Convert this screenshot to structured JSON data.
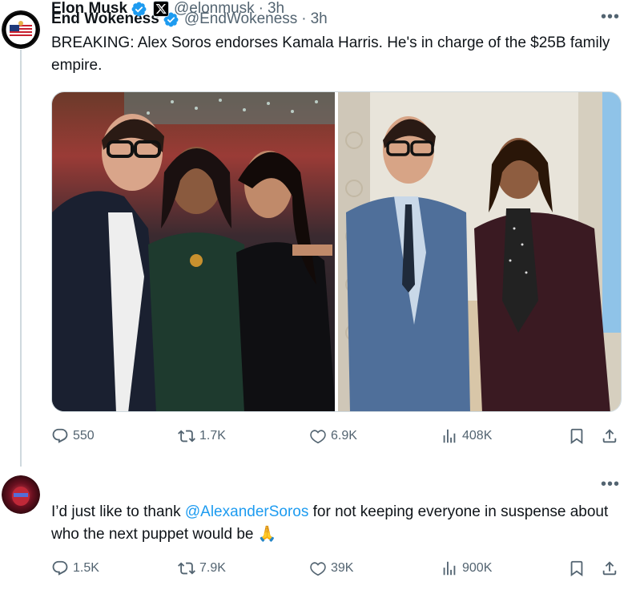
{
  "tweets": [
    {
      "name": "End Wokeness",
      "handle": "@EndWokeness",
      "time": "3h",
      "separator": "·",
      "avatar_text": "I SUPPORT LAW ENFORCEMENT",
      "text": "BREAKING: Alex Soros endorses Kamala Harris. He's in charge of the $25B family empire.",
      "stats": {
        "replies": "550",
        "reposts": "1.7K",
        "likes": "6.9K",
        "views": "408K"
      }
    },
    {
      "name": "Elon Musk",
      "handle": "@elonmusk",
      "time": "3h",
      "separator": "·",
      "text_before": "I’d just like to thank ",
      "mention": "@AlexanderSoros",
      "text_after": " for not keeping everyone in suspense about who the next puppet would be ",
      "emoji": "🙏",
      "stats": {
        "replies": "1.5K",
        "reposts": "7.9K",
        "likes": "39K",
        "views": "900K"
      }
    }
  ],
  "colors": {
    "accent": "#1d9bf0",
    "muted": "#536471",
    "line": "#cfd9de"
  },
  "icons": [
    "verified-badge-icon",
    "more-icon",
    "reply-icon",
    "repost-icon",
    "like-icon",
    "views-icon",
    "bookmark-icon",
    "share-icon"
  ]
}
